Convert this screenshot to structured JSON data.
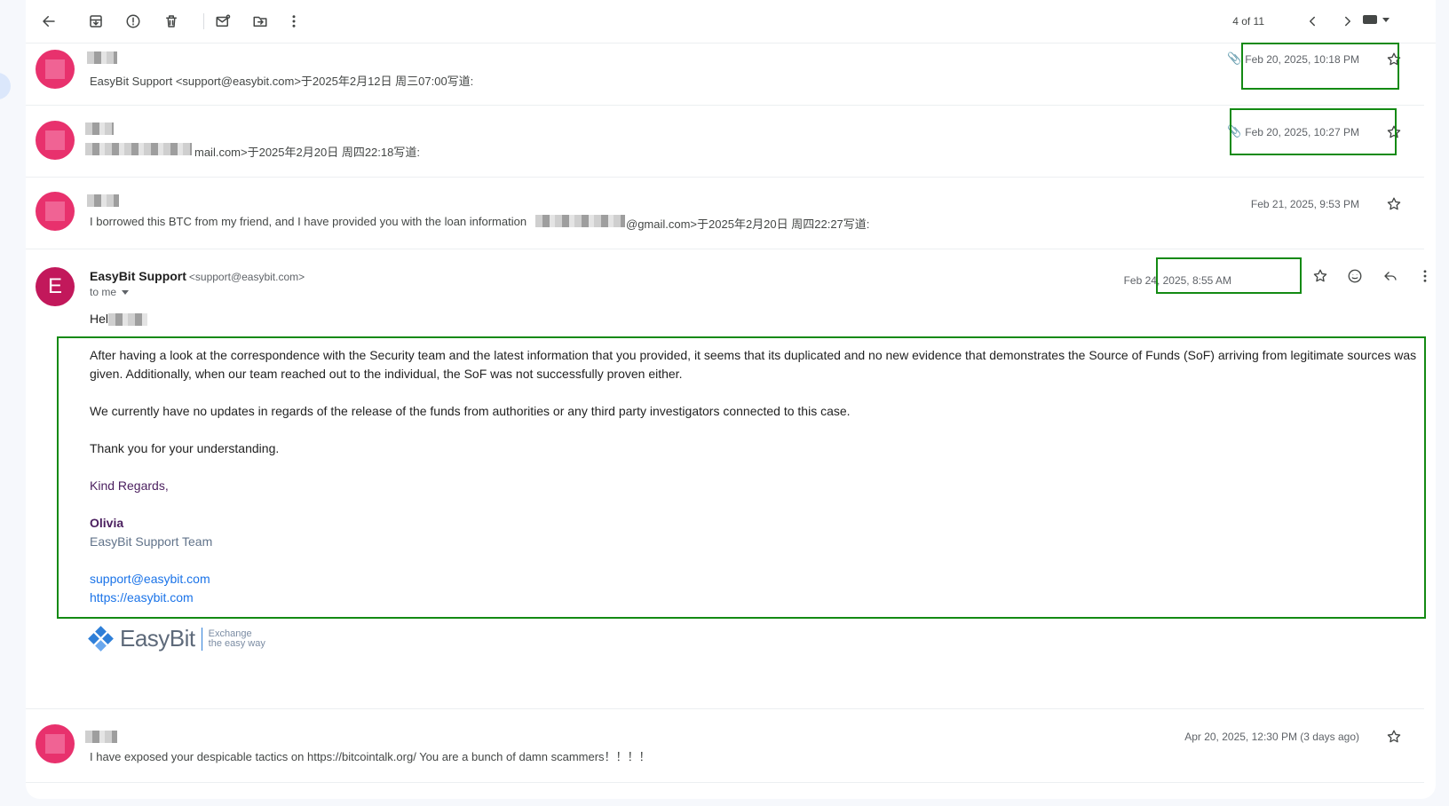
{
  "toolbar": {
    "pager": "4 of 11"
  },
  "messages": [
    {
      "snippet": "EasyBit Support <support@easybit.com>于2025年2月12日 周三07:00写道:",
      "date": "Feb 20, 2025, 10:18 PM",
      "attachment": true
    },
    {
      "snippet": "mail.com>于2025年2月20日 周四22:18写道:",
      "date": "Feb 20, 2025, 10:27 PM",
      "attachment": true
    },
    {
      "snippet_a": "I borrowed this BTC from my friend, and I have provided you with the loan information",
      "snippet_b": "@gmail.com>于2025年2月20日 周四22:27写道:",
      "date": "Feb 21, 2025, 9:53 PM",
      "attachment": false
    }
  ],
  "expanded": {
    "avatar_letter": "E",
    "sender_name": "EasyBit Support",
    "sender_email": "<support@easybit.com>",
    "recipient": "to me",
    "date": "Feb 24, 2025, 8:55 AM",
    "greeting": "Hel",
    "paragraph1": "After having a look at the correspondence with the Security team and the latest information that you provided, it seems that its duplicated and no new evidence that demonstrates the Source of Funds (SoF) arriving from legitimate sources was given. Additionally, when our team reached out to the individual, the SoF was not successfully proven either.",
    "paragraph2": "We currently have no updates in regards of the release of the funds from authorities or any third party investigators connected to this case.",
    "paragraph3": "Thank you for your understanding.",
    "closing": "Kind Regards,",
    "signer": "Olivia",
    "team": "EasyBit Support Team",
    "email_link": "support@easybit.com",
    "site_link": "https://easybit.com",
    "logo_name": "EasyBit",
    "logo_tagline_1": "Exchange",
    "logo_tagline_2": "the easy way"
  },
  "last_message": {
    "snippet": "I have exposed your despicable tactics on https://bitcointalk.org/ You are a bunch of damn scammers！！！！",
    "date": "Apr 20, 2025, 12:30 PM (3 days ago)"
  },
  "colors": {
    "highlight_border": "#138a13",
    "avatar_pink": "#e8316d",
    "avatar_letter_bg": "#c2185b",
    "link": "#1a73e8"
  },
  "icons": [
    "back-icon",
    "archive-icon",
    "report-spam-icon",
    "delete-icon",
    "mark-unread-icon",
    "move-to-icon",
    "more-vert-icon",
    "chevron-left-icon",
    "chevron-right-icon",
    "keyboard-icon",
    "attachment-icon",
    "star-icon",
    "emoji-icon",
    "reply-icon"
  ]
}
